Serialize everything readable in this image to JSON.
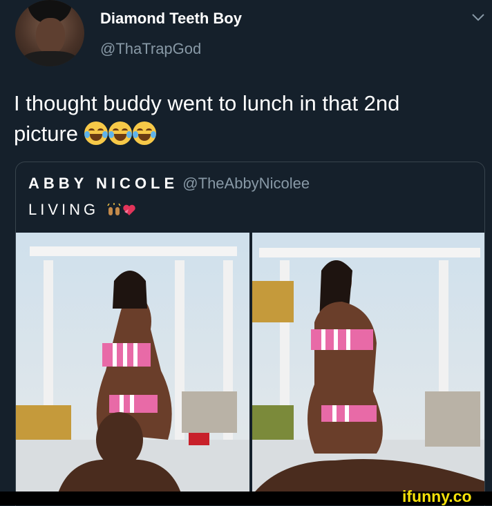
{
  "author": {
    "display_name": "Diamond Teeth Boy",
    "handle": "@ThaTrapGod"
  },
  "tweet": {
    "text": "I thought buddy went to lunch in that 2nd picture",
    "emojis": [
      "face-with-tears-of-joy",
      "face-with-tears-of-joy",
      "face-with-tears-of-joy"
    ]
  },
  "quoted": {
    "display_name": "ABBY NICOLE",
    "handle": "@TheAbbyNicolee",
    "text": "LIVING",
    "emojis": [
      "raising-hands",
      "heart-with-ribbon"
    ]
  },
  "watermark": "ifunny.co",
  "colors": {
    "background": "#15202b",
    "secondary_text": "#8899a6",
    "border": "#38444d",
    "watermark": "#f7e20a"
  }
}
